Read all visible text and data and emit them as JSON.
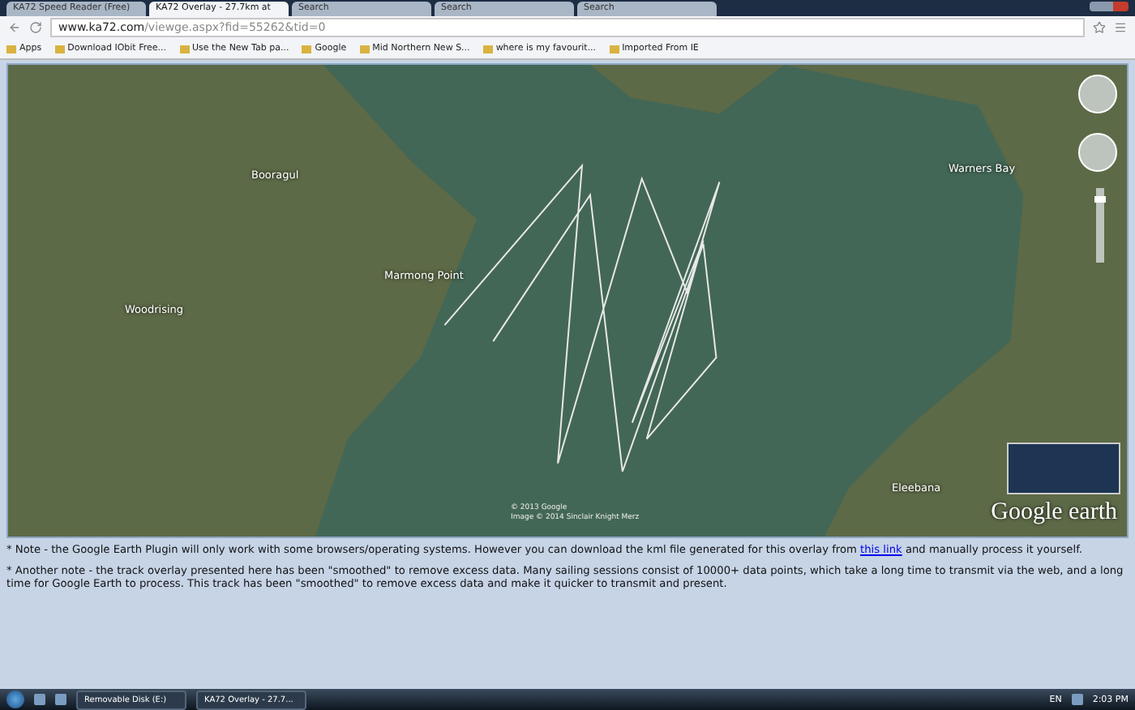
{
  "browser": {
    "tabs": [
      {
        "title": "KA72 Speed Reader (Free)",
        "selected": false
      },
      {
        "title": "KA72 Overlay - 27.7km at",
        "selected": true
      },
      {
        "title": "Search",
        "selected": false
      },
      {
        "title": "Search",
        "selected": false
      },
      {
        "title": "Search",
        "selected": false
      }
    ],
    "address": {
      "host": "www.ka72.com",
      "path": "/viewge.aspx?fid=55262&tid=0"
    },
    "bookmarks": [
      "Apps",
      "Download IObit Free...",
      "Use the New Tab pa...",
      "Google",
      "Mid Northern New S...",
      "where is my favourit...",
      "Imported From IE"
    ]
  },
  "map": {
    "labels": [
      "Booragul",
      "Woodrising",
      "Marmong Point",
      "Warners Bay",
      "Eleebana"
    ],
    "zoom": {
      "level": 0.88
    },
    "copyright": [
      "© 2013 Google",
      "Image © 2014 Sinclair Knight Merz"
    ],
    "logo": "Google earth"
  },
  "notes": [
    {
      "text": "* Note - the Google Earth Plugin will only work with some browsers/operating systems. However you can download the kml file generated for this overlay from ",
      "link": "this link",
      "after": " and manually process it yourself."
    },
    {
      "text": "* Another note - the track overlay presented here has been \"smoothed\" to remove excess data. Many sailing sessions consist of 10000+ data points, which take a long time to transmit via the web, and a long time for Google Earth to process. This track has been \"smoothed\" to remove excess data and make it quicker to transmit and present."
    }
  ],
  "taskbar": {
    "windows": [
      "Removable Disk (E:)",
      "KA72 Overlay - 27.7..."
    ],
    "language": "EN",
    "time": "2:03 PM"
  }
}
